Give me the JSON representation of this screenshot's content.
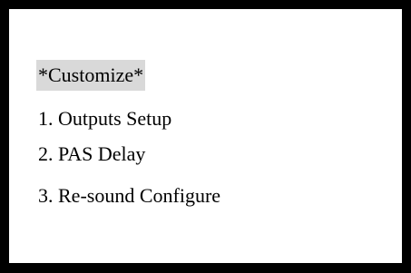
{
  "menu": {
    "title": "*Customize*",
    "items": [
      {
        "label": "1. Outputs Setup"
      },
      {
        "label": "2. PAS Delay"
      },
      {
        "label": "3. Re-sound Configure"
      }
    ]
  },
  "colors": {
    "frame": "#000000",
    "background": "#ffffff",
    "title_highlight": "#d9d9d9",
    "text": "#000000"
  }
}
